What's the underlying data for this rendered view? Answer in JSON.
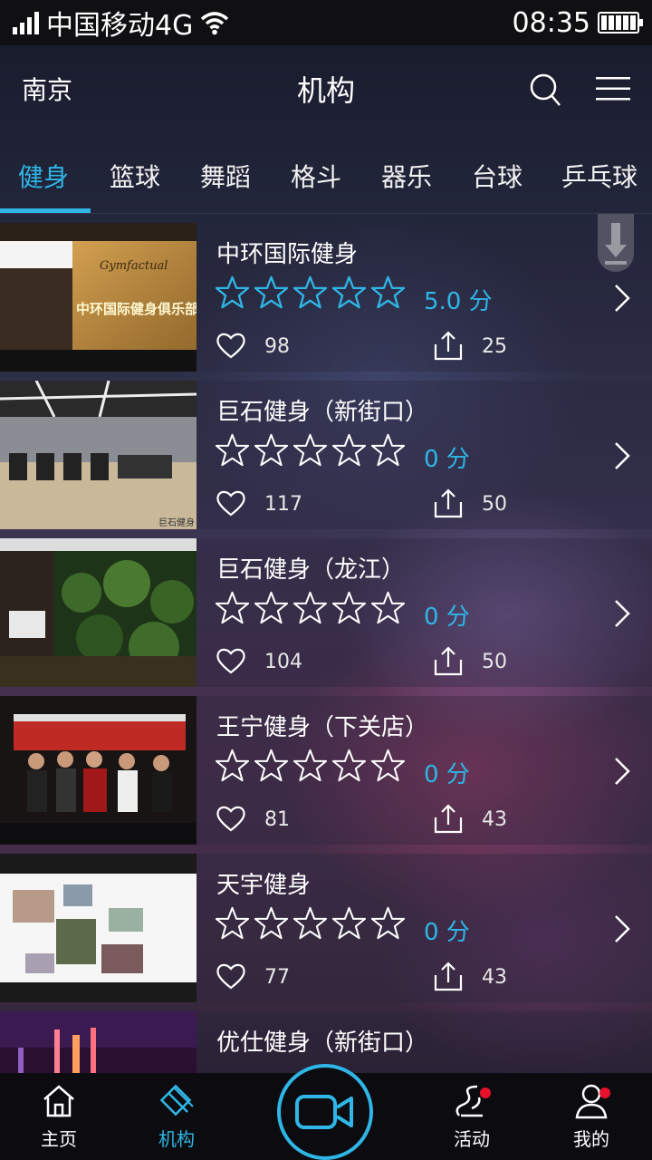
{
  "status_bar": {
    "carrier": "中国移动4G",
    "time": "08:35"
  },
  "top_bar": {
    "city": "南京",
    "title": "机构"
  },
  "tabs": [
    {
      "label": "健身",
      "active": true
    },
    {
      "label": "篮球",
      "active": false
    },
    {
      "label": "舞蹈",
      "active": false
    },
    {
      "label": "格斗",
      "active": false
    },
    {
      "label": "器乐",
      "active": false
    },
    {
      "label": "台球",
      "active": false
    },
    {
      "label": "乒乓球",
      "active": false
    }
  ],
  "venues": [
    {
      "name": "中环国际健身",
      "rating": 5.0,
      "score_text": "5.0 分",
      "likes": "98",
      "shares": "25",
      "thumb_text": "中环国际健身俱乐部",
      "thumb_logo": "Gymfactual"
    },
    {
      "name": "巨石健身（新街口）",
      "rating": 0,
      "score_text": "0 分",
      "likes": "117",
      "shares": "50",
      "thumb_text": "巨石健身"
    },
    {
      "name": "巨石健身（龙江）",
      "rating": 0,
      "score_text": "0 分",
      "likes": "104",
      "shares": "50"
    },
    {
      "name": "王宁健身（下关店）",
      "rating": 0,
      "score_text": "0 分",
      "likes": "81",
      "shares": "43"
    },
    {
      "name": "天宇健身",
      "rating": 0,
      "score_text": "0 分",
      "likes": "77",
      "shares": "43"
    },
    {
      "name": "优仕健身（新街口）",
      "rating": 0,
      "score_text": "",
      "likes": "",
      "shares": ""
    }
  ],
  "bottom_nav": [
    {
      "label": "主页",
      "icon": "home-icon",
      "active": false
    },
    {
      "label": "机构",
      "icon": "venue-icon",
      "active": true
    },
    {
      "label": "活动",
      "icon": "activity-icon",
      "active": false,
      "badge": true
    },
    {
      "label": "我的",
      "icon": "profile-icon",
      "active": false,
      "badge": true
    }
  ],
  "colors": {
    "accent": "#2fb6e6",
    "badge": "#e8102a"
  }
}
